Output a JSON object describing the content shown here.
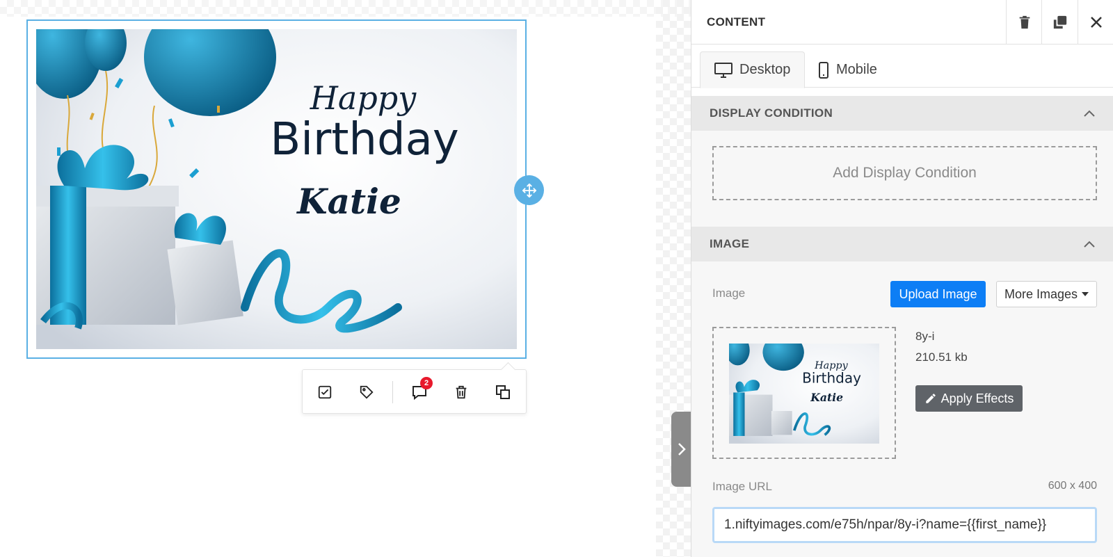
{
  "canvas": {
    "image_alt": "Happy Birthday Katie",
    "card_text": {
      "line1": "Happy",
      "line2": "Birthday",
      "line3": "Katie"
    },
    "toolbar": {
      "comment_count": "2"
    }
  },
  "panel": {
    "title": "CONTENT",
    "tabs": [
      {
        "label": "Desktop",
        "icon": "desktop-icon",
        "active": true
      },
      {
        "label": "Mobile",
        "icon": "mobile-icon",
        "active": false
      }
    ],
    "display_condition": {
      "header": "DISPLAY CONDITION",
      "add_label": "Add Display Condition"
    },
    "image_section": {
      "header": "IMAGE",
      "image_label": "Image",
      "upload_label": "Upload Image",
      "more_label": "More Images",
      "file_name": "8y-i",
      "file_size": "210.51 kb",
      "effects_label": "Apply Effects",
      "url_label": "Image URL",
      "dimensions": "600 x 400",
      "url_value": "1.niftyimages.com/e75h/npar/8y-i?name={{first_name}}"
    }
  },
  "colors": {
    "accent": "#0d7ef5",
    "selection": "#5ab0e4",
    "badge": "#e8192c",
    "ribbon": "#1b9fd1"
  }
}
